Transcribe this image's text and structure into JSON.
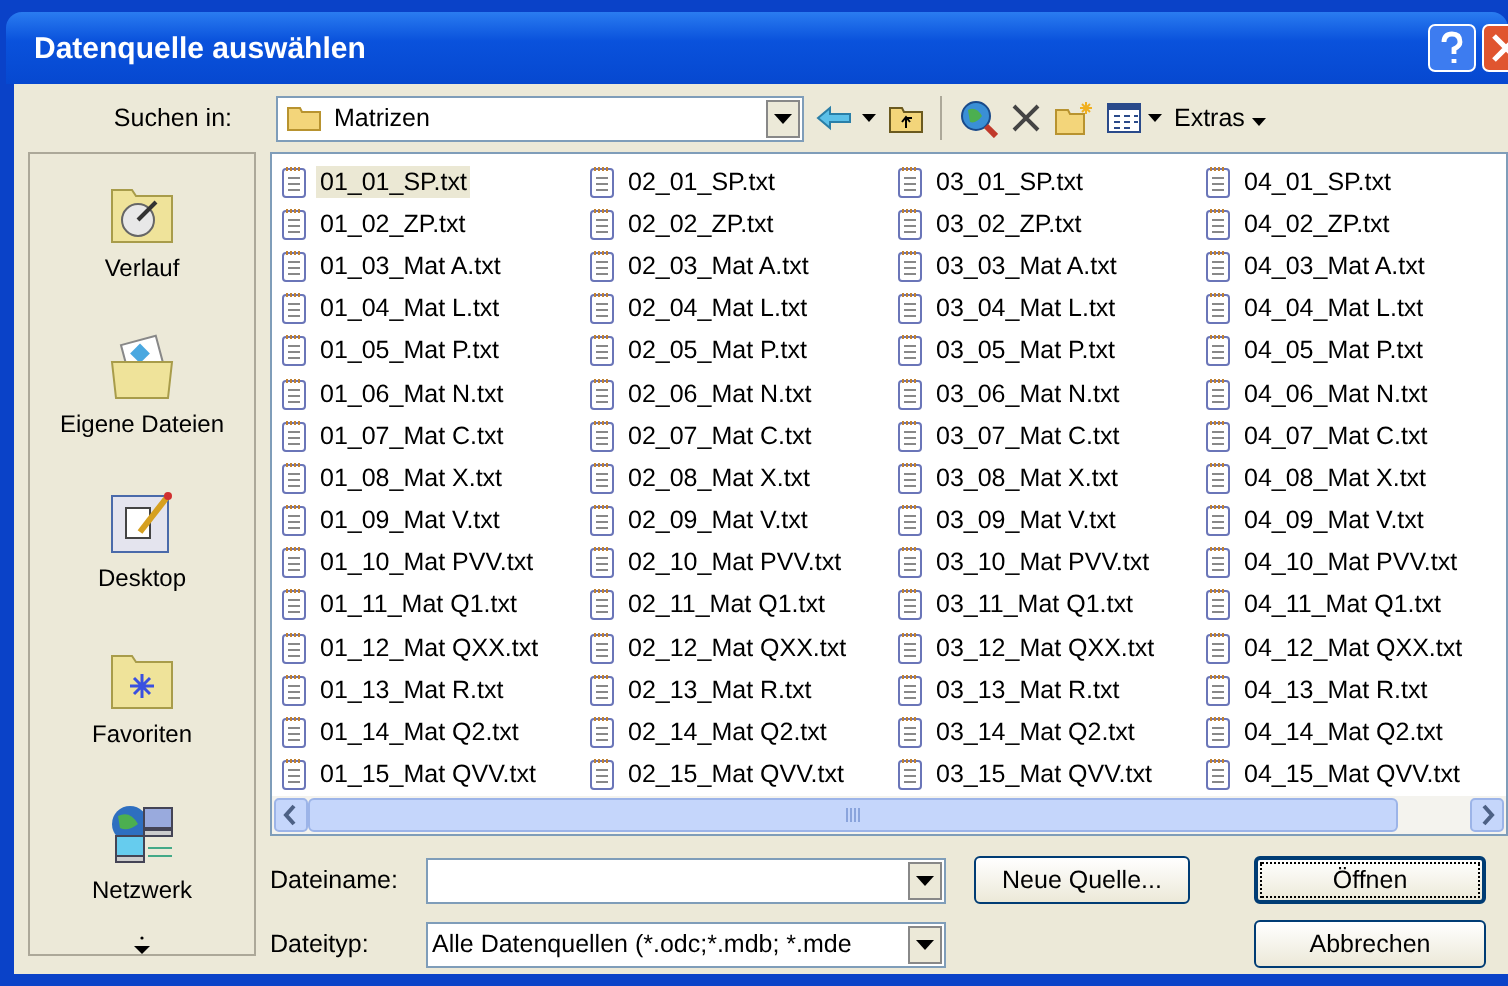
{
  "window": {
    "title": "Datenquelle auswählen"
  },
  "toolbar": {
    "look_in_label": "Suchen in:",
    "folder": "Matrizen",
    "extras": "Extras"
  },
  "sidebar": {
    "items": [
      {
        "label": "Verlauf",
        "kind": "history"
      },
      {
        "label": "Eigene Dateien",
        "kind": "documents"
      },
      {
        "label": "Desktop",
        "kind": "desktop"
      },
      {
        "label": "Favoriten",
        "kind": "favorites"
      },
      {
        "label": "Netzwerk",
        "kind": "network"
      }
    ]
  },
  "files": {
    "columns": [
      [
        {
          "name": "01_01_SP.txt",
          "selected": true
        },
        {
          "name": "01_02_ZP.txt",
          "selected": false
        },
        {
          "name": "01_03_Mat A.txt",
          "selected": false
        },
        {
          "name": "01_04_Mat L.txt",
          "selected": false
        },
        {
          "name": "01_05_Mat P.txt",
          "selected": false
        },
        {
          "name": "01_06_Mat N.txt",
          "selected": false
        },
        {
          "name": "01_07_Mat C.txt",
          "selected": false
        },
        {
          "name": "01_08_Mat X.txt",
          "selected": false
        },
        {
          "name": "01_09_Mat V.txt",
          "selected": false
        },
        {
          "name": "01_10_Mat PVV.txt",
          "selected": false
        },
        {
          "name": "01_11_Mat Q1.txt",
          "selected": false
        },
        {
          "name": "01_12_Mat QXX.txt",
          "selected": false
        },
        {
          "name": "01_13_Mat R.txt",
          "selected": false
        },
        {
          "name": "01_14_Mat Q2.txt",
          "selected": false
        },
        {
          "name": "01_15_Mat QVV.txt",
          "selected": false
        }
      ],
      [
        {
          "name": "02_01_SP.txt",
          "selected": false
        },
        {
          "name": "02_02_ZP.txt",
          "selected": false
        },
        {
          "name": "02_03_Mat A.txt",
          "selected": false
        },
        {
          "name": "02_04_Mat L.txt",
          "selected": false
        },
        {
          "name": "02_05_Mat P.txt",
          "selected": false
        },
        {
          "name": "02_06_Mat N.txt",
          "selected": false
        },
        {
          "name": "02_07_Mat C.txt",
          "selected": false
        },
        {
          "name": "02_08_Mat X.txt",
          "selected": false
        },
        {
          "name": "02_09_Mat V.txt",
          "selected": false
        },
        {
          "name": "02_10_Mat PVV.txt",
          "selected": false
        },
        {
          "name": "02_11_Mat Q1.txt",
          "selected": false
        },
        {
          "name": "02_12_Mat QXX.txt",
          "selected": false
        },
        {
          "name": "02_13_Mat R.txt",
          "selected": false
        },
        {
          "name": "02_14_Mat Q2.txt",
          "selected": false
        },
        {
          "name": "02_15_Mat QVV.txt",
          "selected": false
        }
      ],
      [
        {
          "name": "03_01_SP.txt",
          "selected": false
        },
        {
          "name": "03_02_ZP.txt",
          "selected": false
        },
        {
          "name": "03_03_Mat A.txt",
          "selected": false
        },
        {
          "name": "03_04_Mat L.txt",
          "selected": false
        },
        {
          "name": "03_05_Mat P.txt",
          "selected": false
        },
        {
          "name": "03_06_Mat N.txt",
          "selected": false
        },
        {
          "name": "03_07_Mat C.txt",
          "selected": false
        },
        {
          "name": "03_08_Mat X.txt",
          "selected": false
        },
        {
          "name": "03_09_Mat V.txt",
          "selected": false
        },
        {
          "name": "03_10_Mat PVV.txt",
          "selected": false
        },
        {
          "name": "03_11_Mat Q1.txt",
          "selected": false
        },
        {
          "name": "03_12_Mat QXX.txt",
          "selected": false
        },
        {
          "name": "03_13_Mat R.txt",
          "selected": false
        },
        {
          "name": "03_14_Mat Q2.txt",
          "selected": false
        },
        {
          "name": "03_15_Mat QVV.txt",
          "selected": false
        }
      ],
      [
        {
          "name": "04_01_SP.txt",
          "selected": false
        },
        {
          "name": "04_02_ZP.txt",
          "selected": false
        },
        {
          "name": "04_03_Mat A.txt",
          "selected": false
        },
        {
          "name": "04_04_Mat L.txt",
          "selected": false
        },
        {
          "name": "04_05_Mat P.txt",
          "selected": false
        },
        {
          "name": "04_06_Mat N.txt",
          "selected": false
        },
        {
          "name": "04_07_Mat C.txt",
          "selected": false
        },
        {
          "name": "04_08_Mat X.txt",
          "selected": false
        },
        {
          "name": "04_09_Mat V.txt",
          "selected": false
        },
        {
          "name": "04_10_Mat PVV.txt",
          "selected": false
        },
        {
          "name": "04_11_Mat Q1.txt",
          "selected": false
        },
        {
          "name": "04_12_Mat QXX.txt",
          "selected": false
        },
        {
          "name": "04_13_Mat R.txt",
          "selected": false
        },
        {
          "name": "04_14_Mat Q2.txt",
          "selected": false
        },
        {
          "name": "04_15_Mat QVV.txt",
          "selected": false
        }
      ]
    ]
  },
  "form": {
    "filename_label": "Dateiname:",
    "filetype_label": "Dateityp:",
    "filetype_value": "Alle Datenquellen (*.odc;*.mdb; *.mde"
  },
  "buttons": {
    "new_source": "Neue Quelle...",
    "open": "Öffnen",
    "cancel": "Abbrechen"
  }
}
